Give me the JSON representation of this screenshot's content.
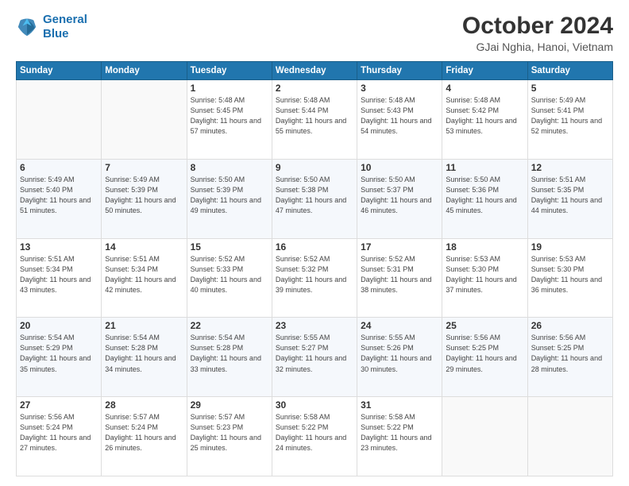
{
  "header": {
    "logo_line1": "General",
    "logo_line2": "Blue",
    "month": "October 2024",
    "location": "GJai Nghia, Hanoi, Vietnam"
  },
  "days_header": [
    "Sunday",
    "Monday",
    "Tuesday",
    "Wednesday",
    "Thursday",
    "Friday",
    "Saturday"
  ],
  "weeks": [
    [
      {
        "num": "",
        "info": ""
      },
      {
        "num": "",
        "info": ""
      },
      {
        "num": "1",
        "info": "Sunrise: 5:48 AM\nSunset: 5:45 PM\nDaylight: 11 hours\nand 57 minutes."
      },
      {
        "num": "2",
        "info": "Sunrise: 5:48 AM\nSunset: 5:44 PM\nDaylight: 11 hours\nand 55 minutes."
      },
      {
        "num": "3",
        "info": "Sunrise: 5:48 AM\nSunset: 5:43 PM\nDaylight: 11 hours\nand 54 minutes."
      },
      {
        "num": "4",
        "info": "Sunrise: 5:48 AM\nSunset: 5:42 PM\nDaylight: 11 hours\nand 53 minutes."
      },
      {
        "num": "5",
        "info": "Sunrise: 5:49 AM\nSunset: 5:41 PM\nDaylight: 11 hours\nand 52 minutes."
      }
    ],
    [
      {
        "num": "6",
        "info": "Sunrise: 5:49 AM\nSunset: 5:40 PM\nDaylight: 11 hours\nand 51 minutes."
      },
      {
        "num": "7",
        "info": "Sunrise: 5:49 AM\nSunset: 5:39 PM\nDaylight: 11 hours\nand 50 minutes."
      },
      {
        "num": "8",
        "info": "Sunrise: 5:50 AM\nSunset: 5:39 PM\nDaylight: 11 hours\nand 49 minutes."
      },
      {
        "num": "9",
        "info": "Sunrise: 5:50 AM\nSunset: 5:38 PM\nDaylight: 11 hours\nand 47 minutes."
      },
      {
        "num": "10",
        "info": "Sunrise: 5:50 AM\nSunset: 5:37 PM\nDaylight: 11 hours\nand 46 minutes."
      },
      {
        "num": "11",
        "info": "Sunrise: 5:50 AM\nSunset: 5:36 PM\nDaylight: 11 hours\nand 45 minutes."
      },
      {
        "num": "12",
        "info": "Sunrise: 5:51 AM\nSunset: 5:35 PM\nDaylight: 11 hours\nand 44 minutes."
      }
    ],
    [
      {
        "num": "13",
        "info": "Sunrise: 5:51 AM\nSunset: 5:34 PM\nDaylight: 11 hours\nand 43 minutes."
      },
      {
        "num": "14",
        "info": "Sunrise: 5:51 AM\nSunset: 5:34 PM\nDaylight: 11 hours\nand 42 minutes."
      },
      {
        "num": "15",
        "info": "Sunrise: 5:52 AM\nSunset: 5:33 PM\nDaylight: 11 hours\nand 40 minutes."
      },
      {
        "num": "16",
        "info": "Sunrise: 5:52 AM\nSunset: 5:32 PM\nDaylight: 11 hours\nand 39 minutes."
      },
      {
        "num": "17",
        "info": "Sunrise: 5:52 AM\nSunset: 5:31 PM\nDaylight: 11 hours\nand 38 minutes."
      },
      {
        "num": "18",
        "info": "Sunrise: 5:53 AM\nSunset: 5:30 PM\nDaylight: 11 hours\nand 37 minutes."
      },
      {
        "num": "19",
        "info": "Sunrise: 5:53 AM\nSunset: 5:30 PM\nDaylight: 11 hours\nand 36 minutes."
      }
    ],
    [
      {
        "num": "20",
        "info": "Sunrise: 5:54 AM\nSunset: 5:29 PM\nDaylight: 11 hours\nand 35 minutes."
      },
      {
        "num": "21",
        "info": "Sunrise: 5:54 AM\nSunset: 5:28 PM\nDaylight: 11 hours\nand 34 minutes."
      },
      {
        "num": "22",
        "info": "Sunrise: 5:54 AM\nSunset: 5:28 PM\nDaylight: 11 hours\nand 33 minutes."
      },
      {
        "num": "23",
        "info": "Sunrise: 5:55 AM\nSunset: 5:27 PM\nDaylight: 11 hours\nand 32 minutes."
      },
      {
        "num": "24",
        "info": "Sunrise: 5:55 AM\nSunset: 5:26 PM\nDaylight: 11 hours\nand 30 minutes."
      },
      {
        "num": "25",
        "info": "Sunrise: 5:56 AM\nSunset: 5:25 PM\nDaylight: 11 hours\nand 29 minutes."
      },
      {
        "num": "26",
        "info": "Sunrise: 5:56 AM\nSunset: 5:25 PM\nDaylight: 11 hours\nand 28 minutes."
      }
    ],
    [
      {
        "num": "27",
        "info": "Sunrise: 5:56 AM\nSunset: 5:24 PM\nDaylight: 11 hours\nand 27 minutes."
      },
      {
        "num": "28",
        "info": "Sunrise: 5:57 AM\nSunset: 5:24 PM\nDaylight: 11 hours\nand 26 minutes."
      },
      {
        "num": "29",
        "info": "Sunrise: 5:57 AM\nSunset: 5:23 PM\nDaylight: 11 hours\nand 25 minutes."
      },
      {
        "num": "30",
        "info": "Sunrise: 5:58 AM\nSunset: 5:22 PM\nDaylight: 11 hours\nand 24 minutes."
      },
      {
        "num": "31",
        "info": "Sunrise: 5:58 AM\nSunset: 5:22 PM\nDaylight: 11 hours\nand 23 minutes."
      },
      {
        "num": "",
        "info": ""
      },
      {
        "num": "",
        "info": ""
      }
    ]
  ]
}
